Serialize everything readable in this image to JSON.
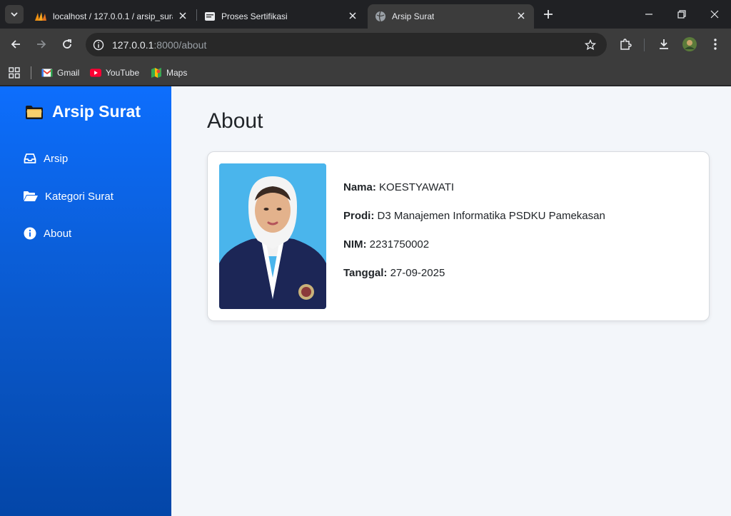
{
  "browser": {
    "tabs": [
      {
        "title": "localhost / 127.0.0.1 / arsip_surat",
        "icon": "phpmyadmin-icon",
        "active": false
      },
      {
        "title": "Proses Sertifikasi",
        "icon": "document-icon",
        "active": false
      },
      {
        "title": "Arsip Surat",
        "icon": "globe-icon",
        "active": true
      }
    ],
    "url_host": "127.0.0.1",
    "url_path": ":8000/about",
    "bookmarks": [
      {
        "label": "Gmail",
        "icon": "gmail-icon"
      },
      {
        "label": "YouTube",
        "icon": "youtube-icon"
      },
      {
        "label": "Maps",
        "icon": "maps-icon"
      }
    ]
  },
  "sidebar": {
    "brand": "Arsip Surat",
    "brand_icon": "folder-icon",
    "items": [
      {
        "label": "Arsip",
        "icon": "inbox-icon"
      },
      {
        "label": "Kategori Surat",
        "icon": "folder-open-icon"
      },
      {
        "label": "About",
        "icon": "info-icon"
      }
    ]
  },
  "main": {
    "title": "About",
    "profile": {
      "nama_label": "Nama:",
      "nama": "KOESTYAWATI",
      "prodi_label": "Prodi:",
      "prodi": "D3 Manajemen Informatika PSDKU Pamekasan",
      "nim_label": "NIM:",
      "nim": "2231750002",
      "tanggal_label": "Tanggal:",
      "tanggal": "27-09-2025"
    }
  },
  "colors": {
    "sidebar_top": "#0d6efd",
    "sidebar_bottom": "#0346a8",
    "page_bg": "#f3f6fa",
    "photo_bg": "#4ab5ec"
  }
}
